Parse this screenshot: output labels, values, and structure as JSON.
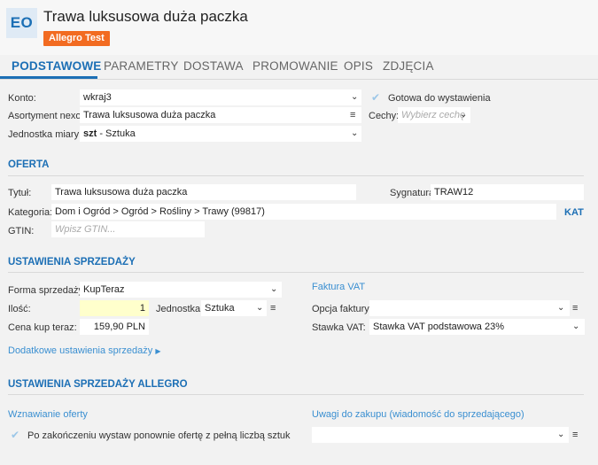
{
  "header": {
    "initials": "EO",
    "title": "Trawa luksusowa duża paczka",
    "badge": "Allegro Test"
  },
  "tabs": [
    {
      "label": "PODSTAWOWE",
      "active": true
    },
    {
      "label": "PARAMETRY"
    },
    {
      "label": "DOSTAWA"
    },
    {
      "label": "PROMOWANIE"
    },
    {
      "label": "OPIS"
    },
    {
      "label": "ZDJĘCIA"
    }
  ],
  "general": {
    "konto_label": "Konto:",
    "konto_value": "wkraj3",
    "gotowa_label": "Gotowa do wystawienia",
    "asortyment_label": "Asortyment nexo:",
    "asortyment_value": "Trawa luksusowa duża paczka",
    "cechy_label": "Cechy:",
    "cechy_placeholder": "Wybierz cechę",
    "jednostka_label": "Jednostka miary:",
    "jednostka_code": "szt",
    "jednostka_name": " - Sztuka"
  },
  "oferta": {
    "heading": "OFERTA",
    "tytul_label": "Tytuł:",
    "tytul_value": "Trawa luksusowa duża paczka",
    "sygnatura_label": "Sygnatura:",
    "sygnatura_value": "TRAW12",
    "kategoria_label": "Kategoria:",
    "kategoria_value": "Dom i Ogród > Ogród > Rośliny > Trawy (99817)",
    "kat_button": "KAT",
    "gtin_label": "GTIN:",
    "gtin_placeholder": "Wpisz GTIN..."
  },
  "sprzedaz": {
    "heading": "USTAWIENIA SPRZEDAŻY",
    "forma_label": "Forma sprzedaży:",
    "forma_value": "KupTeraz",
    "ilosc_label": "Ilość:",
    "ilosc_value": "1",
    "jednostka_label": "Jednostka:",
    "jednostka_value": "Sztuka",
    "cena_label": "Cena kup teraz:",
    "cena_value": "159,90",
    "cena_currency": "PLN",
    "faktura_heading": "Faktura VAT",
    "opcja_label": "Opcja faktury:",
    "opcja_value": "",
    "stawka_label": "Stawka VAT:",
    "stawka_value": "Stawka VAT podstawowa 23%",
    "dodatkowe_link": "Dodatkowe ustawienia sprzedaży"
  },
  "allegro": {
    "heading": "USTAWIENIA SPRZEDAŻY ALLEGRO",
    "wznawianie_heading": "Wznawianie oferty",
    "wznawianie_option": "Po zakończeniu wystaw ponownie ofertę z pełną liczbą sztuk",
    "uwagi_heading": "Uwagi do zakupu (wiadomość do sprzedającego)",
    "uwagi_value": ""
  },
  "colors": {
    "accent": "#1c6fb5",
    "badge": "#f26b21",
    "link": "#3a8fd1",
    "highlight_input": "#ffffcc"
  }
}
